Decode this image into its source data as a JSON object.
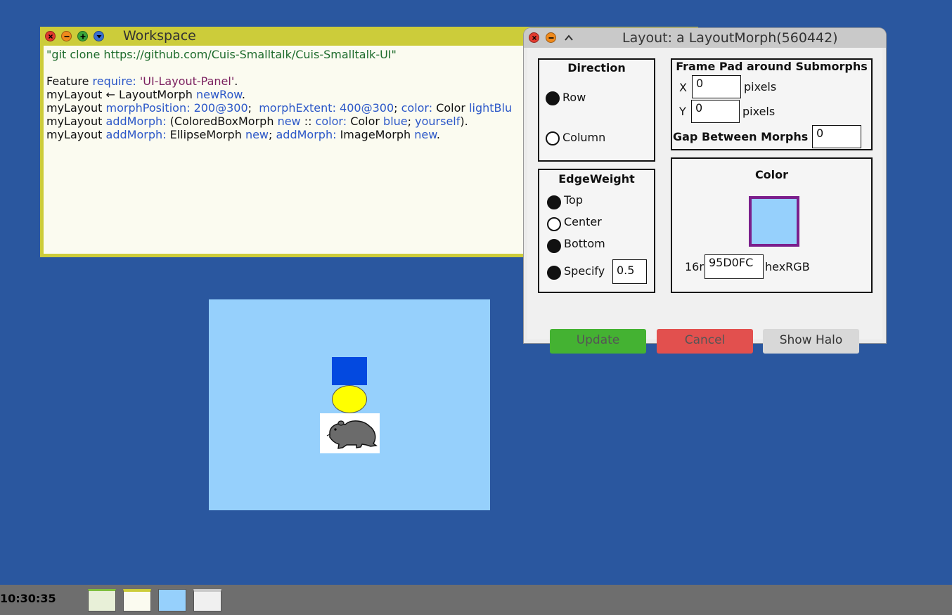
{
  "workspace": {
    "title": "Workspace",
    "lines": [
      [
        "\"git clone https://github.com/Cuis-Smalltalk/Cuis-Smalltalk-UI\""
      ],
      [
        ""
      ],
      [
        "Feature ",
        "require: ",
        "'UI-Layout-Panel'",
        "."
      ],
      [
        "myLayout ← LayoutMorph ",
        "newRow",
        "."
      ],
      [
        "myLayout ",
        "morphPosition: ",
        "200@300",
        ";  ",
        "morphExtent: ",
        "400@300",
        "; ",
        "color: ",
        "Color ",
        "lightBlu"
      ],
      [
        "myLayout ",
        "addMorph: ",
        "(ColoredBoxMorph ",
        "new",
        " :: ",
        "color: ",
        "Color ",
        "blue",
        "; ",
        "yourself",
        ")."
      ],
      [
        "myLayout ",
        "addMorph: ",
        "EllipseMorph ",
        "new",
        "; ",
        "addMorph: ",
        "ImageMorph ",
        "new",
        "."
      ]
    ]
  },
  "layout_dialog": {
    "title": "Layout: a LayoutMorph(560442)",
    "direction": {
      "title": "Direction",
      "options": [
        "Row",
        "Column"
      ],
      "selected": "Row"
    },
    "frame": {
      "title": "Frame Pad around Submorphs",
      "x_label": "X",
      "x_value": "0",
      "y_label": "Y",
      "y_value": "0",
      "unit": "pixels",
      "gap_label": "Gap Between Morphs",
      "gap_value": "0"
    },
    "edge_weight": {
      "title": "EdgeWeight",
      "options": [
        "Top",
        "Center",
        "Bottom",
        "Specify"
      ],
      "specify_value": "0.5"
    },
    "color": {
      "title": "Color",
      "swatch": "#96d0fc",
      "border": "#7b1f8c",
      "prefix": "16r",
      "hex": "95D0FC",
      "suffix": "hexRGB"
    },
    "buttons": {
      "update": "Update",
      "cancel": "Cancel",
      "show_halo": "Show Halo"
    }
  },
  "morph": {
    "background": "#96d0fc",
    "box_color": "#0349e0",
    "ellipse_color": "#ffff00"
  },
  "taskbar": {
    "clock": "10:30:35"
  }
}
